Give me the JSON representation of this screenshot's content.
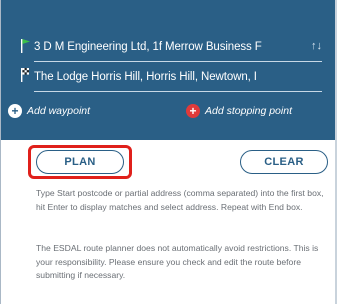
{
  "route": {
    "start_value": "3 D M Engineering Ltd, 1f Merrow Business F",
    "end_value": "The Lodge Horris Hill, Horris Hill, Newtown, I",
    "swap_symbol": "↑↓"
  },
  "actions": {
    "add_waypoint_label": "Add waypoint",
    "add_stopping_point_label": "Add stopping point",
    "plus_symbol": "+"
  },
  "buttons": {
    "plan_label": "PLAN",
    "clear_label": "CLEAR"
  },
  "help": {
    "instructions": "Type Start postcode or partial address (comma separated) into the first box, hit Enter to display matches and select address. Repeat with End box.",
    "disclaimer": "The ESDAL route planner does not automatically avoid restrictions. This is your responsibility. Please ensure you check and edit the route before submitting if necessary."
  },
  "colors": {
    "panel_blue": "#2a5f86",
    "highlight_red": "#e0201b",
    "stop_red": "#e03a3a",
    "start_flag_green": "#3cbf4a"
  },
  "icons": {
    "start": "flag-icon",
    "end": "chequered-flag-icon",
    "waypoint": "plus-circle-icon",
    "stopping_point": "plus-circle-red-icon"
  }
}
